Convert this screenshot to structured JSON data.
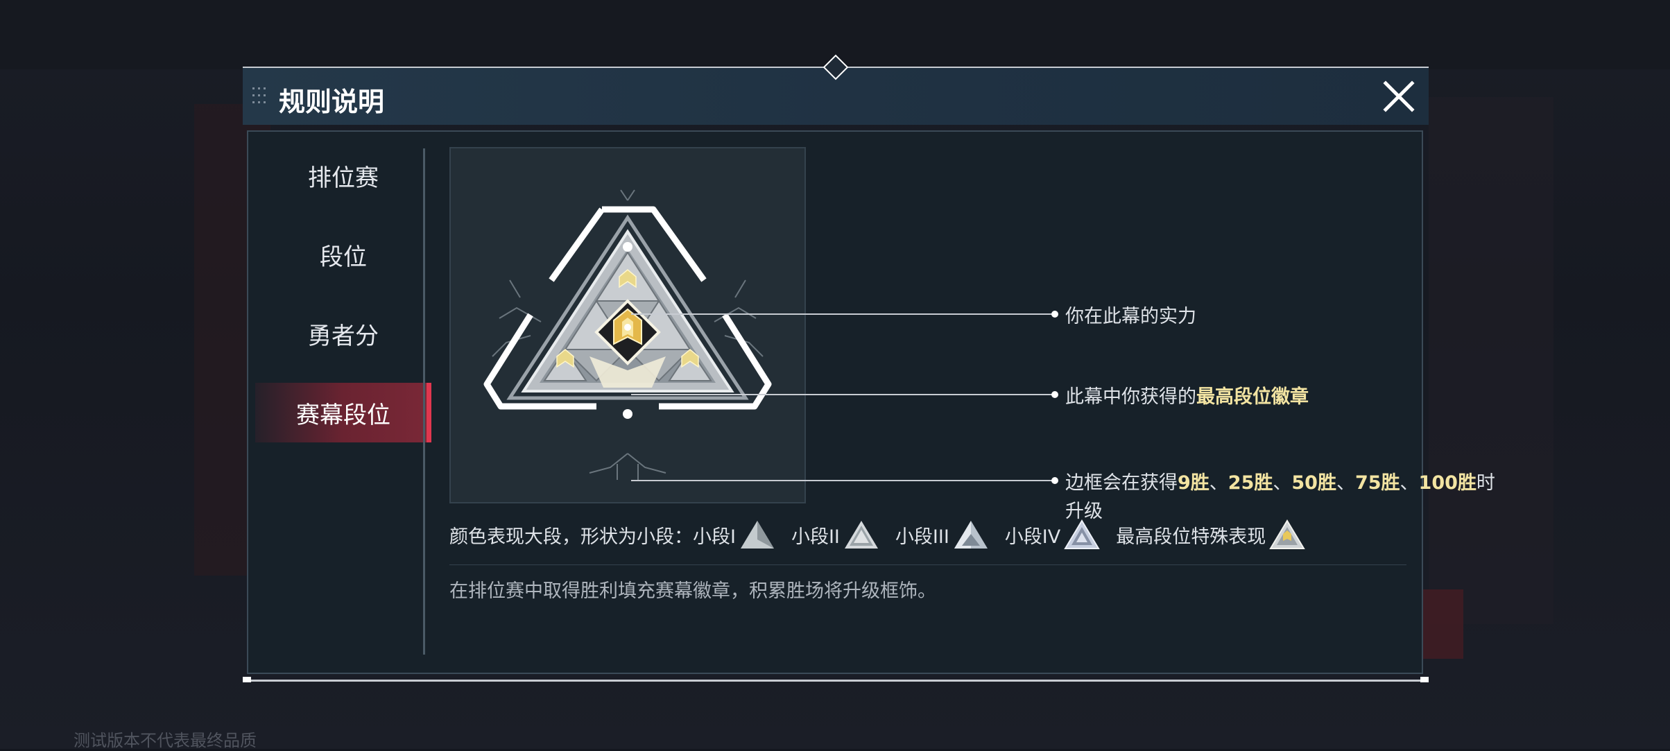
{
  "dialog": {
    "title": "规则说明",
    "close_icon": "close-x-icon"
  },
  "sidebar": {
    "items": [
      {
        "label": "排位赛",
        "active": false
      },
      {
        "label": "段位",
        "active": false
      },
      {
        "label": "勇者分",
        "active": false
      },
      {
        "label": "赛幕段位",
        "active": true
      }
    ]
  },
  "annotations": {
    "strength": "你在此幕的实力",
    "badge_prefix": "此幕中你获得的",
    "badge_highlight": "最高段位徽章",
    "frame_prefix": "边框会在获得",
    "wins": [
      "9胜",
      "25胜",
      "50胜",
      "75胜",
      "100胜"
    ],
    "wins_sep": "、",
    "frame_suffix_line1": "时",
    "frame_suffix_line2": "升级"
  },
  "tiers": {
    "intro": "颜色表现大段，形状为小段：",
    "items": [
      {
        "label": "小段I",
        "icon": "tier-triangle-icon"
      },
      {
        "label": "小段II",
        "icon": "tier-triangle-icon"
      },
      {
        "label": "小段III",
        "icon": "tier-triangle-icon"
      },
      {
        "label": "小段IV",
        "icon": "tier-triangle-icon"
      },
      {
        "label": "最高段位特殊表现",
        "icon": "tier-triangle-gold-icon"
      }
    ]
  },
  "description": "在排位赛中取得胜利填充赛幕徽章，积累胜场将升级框饰。",
  "watermark": "测试版本不代表最终品质",
  "colors": {
    "accent_red": "#e0374f",
    "highlight_gold": "#f3e4a2",
    "header_blue": "#243849"
  }
}
